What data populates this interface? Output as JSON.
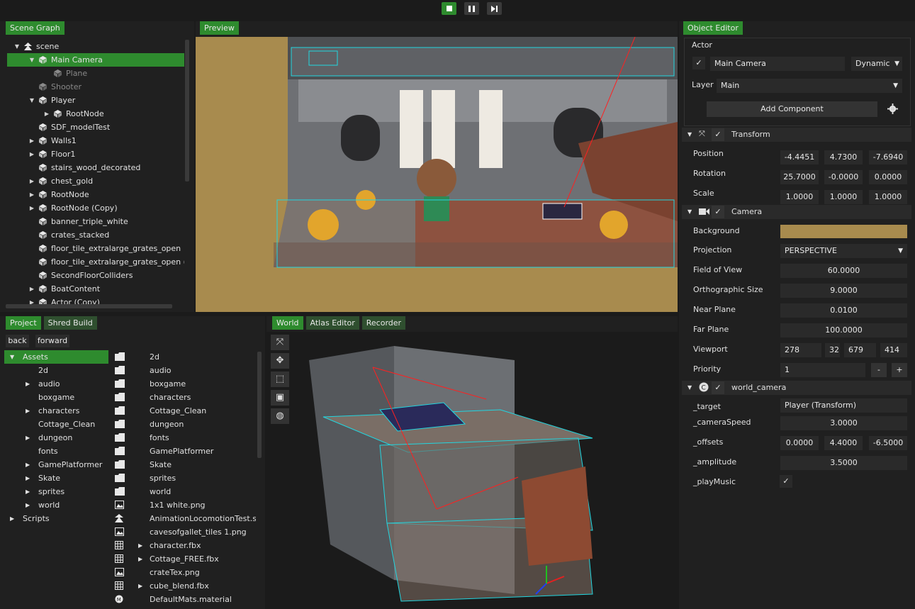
{
  "toolbar": {
    "play_icon": "stop-square-icon",
    "pause_icon": "pause-icon",
    "step_icon": "step-forward-icon"
  },
  "scene_graph": {
    "tab": "Scene Graph",
    "items": [
      {
        "label": "scene",
        "indent": 0,
        "arrow": "▼",
        "icon": "scene-icon"
      },
      {
        "label": "Main Camera",
        "indent": 1,
        "arrow": "▼",
        "selected": true
      },
      {
        "label": "Plane",
        "indent": 2,
        "arrow": "",
        "dim": true
      },
      {
        "label": "Shooter",
        "indent": 1,
        "arrow": "",
        "dim": true
      },
      {
        "label": "Player",
        "indent": 1,
        "arrow": "▼"
      },
      {
        "label": "RootNode",
        "indent": 2,
        "arrow": "▶"
      },
      {
        "label": "SDF_modelTest",
        "indent": 1,
        "arrow": ""
      },
      {
        "label": "Walls1",
        "indent": 1,
        "arrow": "▶"
      },
      {
        "label": "Floor1",
        "indent": 1,
        "arrow": "▶"
      },
      {
        "label": "stairs_wood_decorated",
        "indent": 1,
        "arrow": ""
      },
      {
        "label": "chest_gold",
        "indent": 1,
        "arrow": "▶"
      },
      {
        "label": "RootNode",
        "indent": 1,
        "arrow": "▶"
      },
      {
        "label": "RootNode (Copy)",
        "indent": 1,
        "arrow": "▶"
      },
      {
        "label": "banner_triple_white",
        "indent": 1,
        "arrow": ""
      },
      {
        "label": "crates_stacked",
        "indent": 1,
        "arrow": ""
      },
      {
        "label": "floor_tile_extralarge_grates_open",
        "indent": 1,
        "arrow": ""
      },
      {
        "label": "floor_tile_extralarge_grates_open (Copy",
        "indent": 1,
        "arrow": ""
      },
      {
        "label": "SecondFloorColliders",
        "indent": 1,
        "arrow": ""
      },
      {
        "label": "BoatContent",
        "indent": 1,
        "arrow": "▶"
      },
      {
        "label": "Actor (Copy)",
        "indent": 1,
        "arrow": "▶"
      }
    ]
  },
  "preview": {
    "tab": "Preview"
  },
  "object_editor": {
    "tab": "Object Editor",
    "actor_label": "Actor",
    "actor_name": "Main Camera",
    "actor_type": "Dynamic",
    "layer_label": "Layer",
    "layer_value": "Main",
    "add_component": "Add Component",
    "transform": {
      "title": "Transform",
      "rows": [
        {
          "label": "Position",
          "values": [
            "-4.4451",
            "4.7300",
            "-7.6940"
          ]
        },
        {
          "label": "Rotation",
          "values": [
            "25.7000",
            "-0.0000",
            "0.0000"
          ]
        },
        {
          "label": "Scale",
          "values": [
            "1.0000",
            "1.0000",
            "1.0000"
          ]
        }
      ]
    },
    "camera": {
      "title": "Camera",
      "background_label": "Background",
      "background_color": "#a88b4e",
      "projection_label": "Projection",
      "projection_value": "PERSPECTIVE",
      "fov_label": "Field of View",
      "fov": "60.0000",
      "ortho_label": "Orthographic Size",
      "ortho": "9.0000",
      "near_label": "Near Plane",
      "near": "0.0100",
      "far_label": "Far Plane",
      "far": "100.0000",
      "viewport_label": "Viewport",
      "viewport": [
        "278",
        "32",
        "679",
        "414"
      ],
      "priority_label": "Priority",
      "priority": "1",
      "minus": "-",
      "plus": "+"
    },
    "world_camera": {
      "title": "world_camera",
      "target_label": "_target",
      "target": "Player (Transform)",
      "speed_label": "_cameraSpeed",
      "speed": "3.0000",
      "offsets_label": "_offsets",
      "offsets": [
        "0.0000",
        "4.4000",
        "-6.5000"
      ],
      "amplitude_label": "_amplitude",
      "amplitude": "3.5000",
      "music_label": "_playMusic",
      "check": "✓"
    }
  },
  "project": {
    "tabs": [
      "Project",
      "Shred Build"
    ],
    "back": "back",
    "forward": "forward",
    "folders": [
      {
        "label": "Assets",
        "arrow": "▼",
        "indent": 0,
        "selected": true
      },
      {
        "label": "2d",
        "arrow": "",
        "indent": 1
      },
      {
        "label": "audio",
        "arrow": "▶",
        "indent": 1
      },
      {
        "label": "boxgame",
        "arrow": "",
        "indent": 1
      },
      {
        "label": "characters",
        "arrow": "▶",
        "indent": 1
      },
      {
        "label": "Cottage_Clean",
        "arrow": "",
        "indent": 1
      },
      {
        "label": "dungeon",
        "arrow": "▶",
        "indent": 1
      },
      {
        "label": "fonts",
        "arrow": "",
        "indent": 1
      },
      {
        "label": "GamePlatformer",
        "arrow": "▶",
        "indent": 1
      },
      {
        "label": "Skate",
        "arrow": "▶",
        "indent": 1
      },
      {
        "label": "sprites",
        "arrow": "▶",
        "indent": 1
      },
      {
        "label": "world",
        "arrow": "▶",
        "indent": 1
      },
      {
        "label": "Scripts",
        "arrow": "▶",
        "indent": 0
      }
    ],
    "files": [
      {
        "label": "2d",
        "icon": "folder-icon",
        "arrow": ""
      },
      {
        "label": "audio",
        "icon": "folder-icon",
        "arrow": ""
      },
      {
        "label": "boxgame",
        "icon": "folder-icon",
        "arrow": ""
      },
      {
        "label": "characters",
        "icon": "folder-icon",
        "arrow": ""
      },
      {
        "label": "Cottage_Clean",
        "icon": "folder-icon",
        "arrow": ""
      },
      {
        "label": "dungeon",
        "icon": "folder-icon",
        "arrow": ""
      },
      {
        "label": "fonts",
        "icon": "folder-icon",
        "arrow": ""
      },
      {
        "label": "GamePlatformer",
        "icon": "folder-icon",
        "arrow": ""
      },
      {
        "label": "Skate",
        "icon": "folder-icon",
        "arrow": ""
      },
      {
        "label": "sprites",
        "icon": "folder-icon",
        "arrow": ""
      },
      {
        "label": "world",
        "icon": "folder-icon",
        "arrow": ""
      },
      {
        "label": "1x1 white.png",
        "icon": "image-icon",
        "arrow": ""
      },
      {
        "label": "AnimationLocomotionTest.shred",
        "icon": "scene-icon",
        "arrow": ""
      },
      {
        "label": "cavesofgallet_tiles 1.png",
        "icon": "image-icon",
        "arrow": ""
      },
      {
        "label": "character.fbx",
        "icon": "mesh-icon",
        "arrow": "▶"
      },
      {
        "label": "Cottage_FREE.fbx",
        "icon": "mesh-icon",
        "arrow": "▶"
      },
      {
        "label": "crateTex.png",
        "icon": "image-icon",
        "arrow": ""
      },
      {
        "label": "cube_blend.fbx",
        "icon": "mesh-icon",
        "arrow": "▶"
      },
      {
        "label": "DefaultMats.material",
        "icon": "material-icon",
        "arrow": ""
      }
    ]
  },
  "world": {
    "tabs": [
      "World",
      "Atlas Editor",
      "Recorder"
    ],
    "tools": [
      "move-tool-icon",
      "rotate-tool-icon",
      "scale-tool-icon",
      "rect-tool-icon",
      "globe-icon"
    ]
  }
}
